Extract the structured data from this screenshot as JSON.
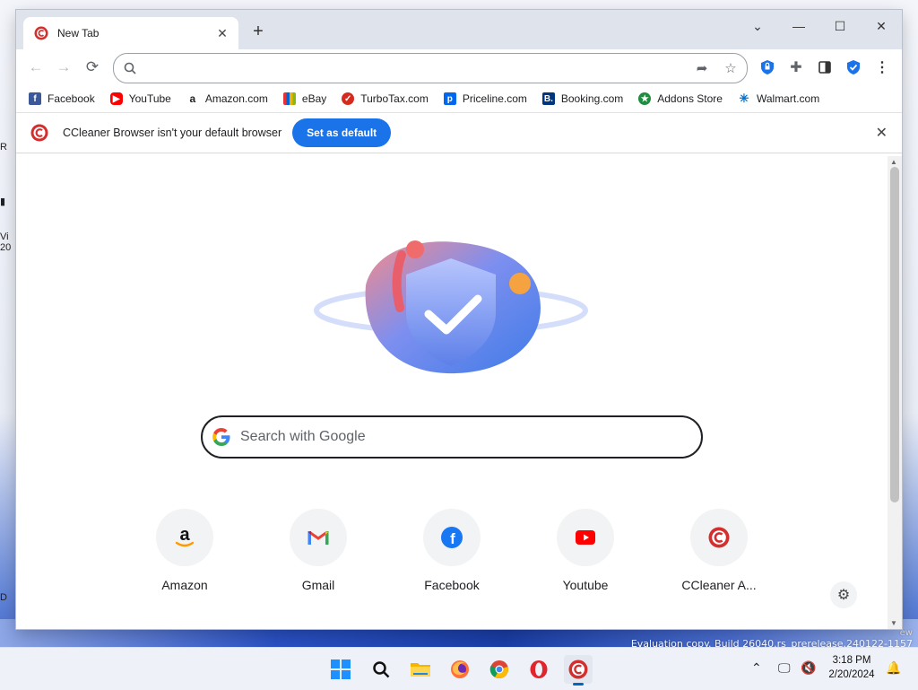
{
  "browser": {
    "tab": {
      "title": "New Tab"
    },
    "omnibox": {
      "placeholder": ""
    },
    "bookmarks": [
      {
        "label": "Facebook",
        "icon": "facebook-icon",
        "color": "#3b5998"
      },
      {
        "label": "YouTube",
        "icon": "youtube-icon",
        "color": "#ff0000"
      },
      {
        "label": "Amazon.com",
        "icon": "amazon-icon",
        "color": "#222222"
      },
      {
        "label": "eBay",
        "icon": "ebay-icon",
        "color": "#e53238"
      },
      {
        "label": "TurboTax.com",
        "icon": "turbotax-icon",
        "color": "#d52b1e"
      },
      {
        "label": "Priceline.com",
        "icon": "priceline-icon",
        "color": "#0068ef"
      },
      {
        "label": "Booking.com",
        "icon": "booking-icon",
        "color": "#003580"
      },
      {
        "label": "Addons Store",
        "icon": "addons-store-icon",
        "color": "#1e8e3e"
      },
      {
        "label": "Walmart.com",
        "icon": "walmart-icon",
        "color": "#0071ce"
      }
    ],
    "infobar": {
      "message": "CCleaner Browser isn't your default browser",
      "button": "Set as default"
    }
  },
  "newtab": {
    "search_placeholder": "Search with Google",
    "shortcuts": [
      {
        "label": "Amazon",
        "icon": "amazon-icon"
      },
      {
        "label": "Gmail",
        "icon": "gmail-icon"
      },
      {
        "label": "Facebook",
        "icon": "facebook-icon"
      },
      {
        "label": "Youtube",
        "icon": "youtube-icon"
      },
      {
        "label": "CCleaner A...",
        "icon": "ccleaner-icon"
      }
    ]
  },
  "desktop": {
    "evaluation_text": "Evaluation copy. Build 26040.rs_prerelease.240122-1157",
    "edition_fragment": "ew"
  },
  "taskbar": {
    "time": "3:18 PM",
    "date": "2/20/2024"
  },
  "colors": {
    "accent": "#1a73e8",
    "ccleaner_red": "#d32f2f"
  }
}
